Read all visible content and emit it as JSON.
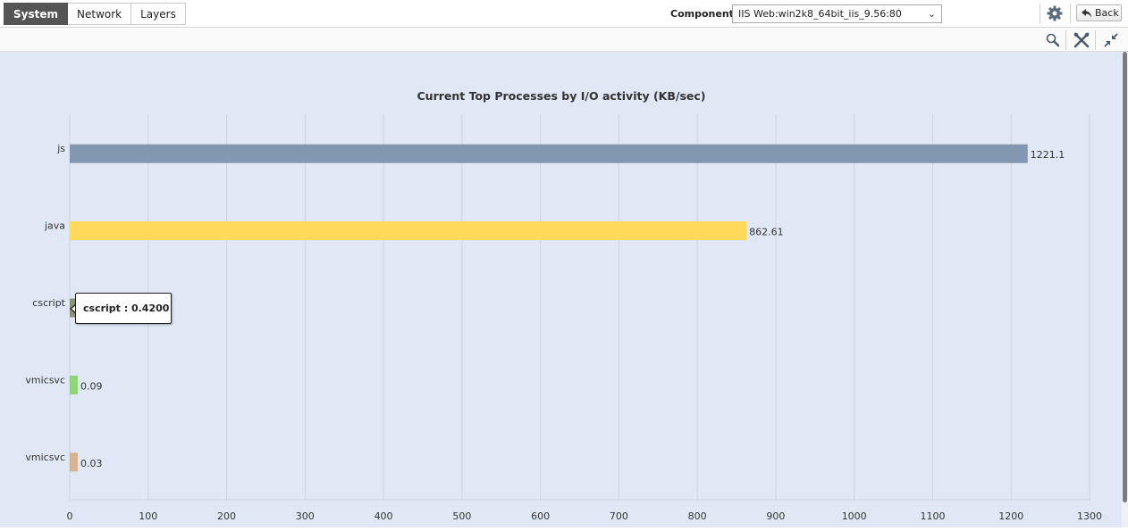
{
  "tabs": [
    {
      "label": "System",
      "active": true
    },
    {
      "label": "Network",
      "active": false
    },
    {
      "label": "Layers",
      "active": false
    }
  ],
  "component": {
    "label": "Component",
    "selected": "IIS Web:win2k8_64bit_iis_9.56:80"
  },
  "header_icons": {
    "settings": "gear-icon",
    "back_arrow": "back-arrow-icon"
  },
  "back_label": "Back",
  "toolbar_icons": [
    "zoom-icon",
    "tools-icon",
    "collapse-icon"
  ],
  "tooltip": {
    "label": "cscript : 0.4200"
  },
  "chart_data": {
    "type": "bar",
    "orientation": "horizontal",
    "title": "Current Top Processes by I/O activity (KB/sec)",
    "categories": [
      "js",
      "java",
      "cscript",
      "vmicsvc",
      "vmicsvc"
    ],
    "values": [
      1221.1,
      862.61,
      0.42,
      0.09,
      0.03
    ],
    "data_labels": [
      "1221.1",
      "862.61",
      "",
      "0.09",
      "0.03"
    ],
    "colors": [
      "#8497b0",
      "#ffd95a",
      "#8a9478",
      "#90d47a",
      "#d4b493"
    ],
    "xlim": [
      0,
      1300
    ],
    "xticks": [
      "0",
      "100",
      "200",
      "300",
      "400",
      "500",
      "600",
      "700",
      "800",
      "900",
      "1000",
      "1100",
      "1200",
      "1300"
    ],
    "grid": true,
    "xlabel": "",
    "ylabel": ""
  }
}
